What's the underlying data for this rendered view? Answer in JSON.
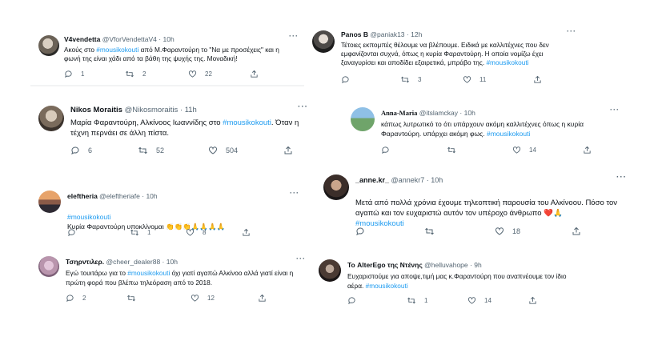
{
  "tweets": [
    {
      "name": "V4vendetta",
      "handle": "@VforVendettaV4",
      "time": "10h",
      "text_parts": [
        "Ακούς στο ",
        "#mousikokouti",
        " από Μ.Φαραντούρη το \"Να με προσέχεις\" και η φωνή της είναι χάδι από τα βάθη της ψυχής της. Μοναδική!"
      ],
      "replies": "1",
      "retweets": "2",
      "likes": "22"
    },
    {
      "name": "Panos B",
      "handle": "@paniak13",
      "time": "12h",
      "text_parts": [
        "Τέτοιες εκπομπές θέλουμε να βλέπουμε. Ειδικά με καλλιτέχνες που δεν εμφανίζονται συχνά, όπως η κυρία Φαραντούρη. Η οποία νομίζω έχει ξαναγυρίσει και αποδίδει εξαιρετικά, μπράβο της. ",
        "#mousikokouti",
        ""
      ],
      "replies": "",
      "retweets": "3",
      "likes": "11"
    },
    {
      "name": "Nikos Moraitis",
      "handle": "@Nikosmoraitis",
      "time": "11h",
      "text_parts": [
        "Μαρία Φαραντούρη, Αλκίνοος Ιωαννίδης στο ",
        "#mousikokouti",
        ". Όταν η τέχνη περνάει σε άλλη πίστα."
      ],
      "replies": "6",
      "retweets": "52",
      "likes": "504"
    },
    {
      "name": "Anna-Maria",
      "handle": "@itslamckay",
      "time": "10h",
      "text_parts": [
        "κάπως λυτρωτικό το ότι υπάρχουν ακόμη καλλιτέχνες όπως η κυρία Φαραντούρη. υπάρχει ακόμη φως. ",
        "#mousikokouti",
        ""
      ],
      "replies": "",
      "retweets": "",
      "likes": "14"
    },
    {
      "name": "eleftheria",
      "handle": "@eleftheriafe",
      "time": "10h",
      "text_parts": [
        "",
        "#mousikokouti",
        "\nΚυρία Φαραντούρη υποκλίνομαι 👏👏👏🙏🙏🙏🙏"
      ],
      "replies": "",
      "retweets": "1",
      "likes": "8"
    },
    {
      "name": "_anne.kr_",
      "handle": "@annekr7",
      "time": "10h",
      "text_parts": [
        "Μετά από πολλά χρόνια έχουμε τηλεοπτική παρουσία του Αλκίνοου. Πόσο τον αγαπώ και τον ευχαριστώ αυτόν τον υπέροχο άνθρωπο ❤️🙏\n",
        "#mousikokouti",
        ""
      ],
      "replies": "",
      "retweets": "",
      "likes": "18"
    },
    {
      "name": "Τσηρντιλερ.",
      "handle": "@cheer_dealer88",
      "time": "10h",
      "text_parts": [
        "Εγώ τουιτάρω για το ",
        "#mousikokouti",
        " όχι γιατί αγαπώ Αλκίνοο αλλά γιατί είναι η πρώτη φορά που βλέπω τηλεόραση από το 2018."
      ],
      "replies": "2",
      "retweets": "",
      "likes": "12"
    },
    {
      "name": "Το AlterEgo της Ντένης",
      "handle": "@helluvahope",
      "time": "9h",
      "text_parts": [
        "Ευχαριστούμε για αποψε,τιμή μας κ.Φαραντούρη που αναπνέουμε τον ίδιο αέρα. ",
        "#mousikokouti",
        ""
      ],
      "replies": "",
      "retweets": "1",
      "likes": "14"
    }
  ],
  "icons": {
    "reply": "reply-icon",
    "retweet": "retweet-icon",
    "like": "like-icon",
    "share": "share-icon",
    "more": "more-icon"
  },
  "colors": {
    "hashtag": "#1d9bf0",
    "secondary": "#536471",
    "text": "#0f1419"
  }
}
